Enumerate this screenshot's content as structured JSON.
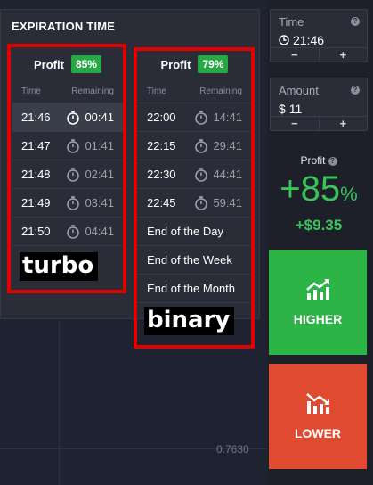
{
  "chart": {
    "price_label": "0.7630"
  },
  "expiration": {
    "title": "EXPIRATION TIME",
    "turbo": {
      "profit_label": "Profit",
      "profit_badge": "85%",
      "col_time": "Time",
      "col_remaining": "Remaining",
      "rows": [
        {
          "time": "21:46",
          "remaining": "00:41"
        },
        {
          "time": "21:47",
          "remaining": "01:41"
        },
        {
          "time": "21:48",
          "remaining": "02:41"
        },
        {
          "time": "21:49",
          "remaining": "03:41"
        },
        {
          "time": "21:50",
          "remaining": "04:41"
        }
      ],
      "caption": "turbo"
    },
    "binary": {
      "profit_label": "Profit",
      "profit_badge": "79%",
      "col_time": "Time",
      "col_remaining": "Remaining",
      "rows": [
        {
          "time": "22:00",
          "remaining": "14:41"
        },
        {
          "time": "22:15",
          "remaining": "29:41"
        },
        {
          "time": "22:30",
          "remaining": "44:41"
        },
        {
          "time": "22:45",
          "remaining": "59:41"
        }
      ],
      "options": [
        "End of the Day",
        "End of the Week",
        "End of the Month"
      ],
      "caption": "binary"
    }
  },
  "time_field": {
    "label": "Time",
    "value": "21:46",
    "minus": "−",
    "plus": "+"
  },
  "amount_field": {
    "label": "Amount",
    "currency": "$",
    "value": "11",
    "minus": "−",
    "plus": "+"
  },
  "profit": {
    "label": "Profit",
    "sign": "+",
    "value": "85",
    "unit": "%",
    "amount": "+$9.35"
  },
  "buttons": {
    "higher": "HIGHER",
    "lower": "LOWER"
  },
  "colors": {
    "green": "#2db447",
    "red": "#df4a30",
    "highlight": "#e00000"
  }
}
